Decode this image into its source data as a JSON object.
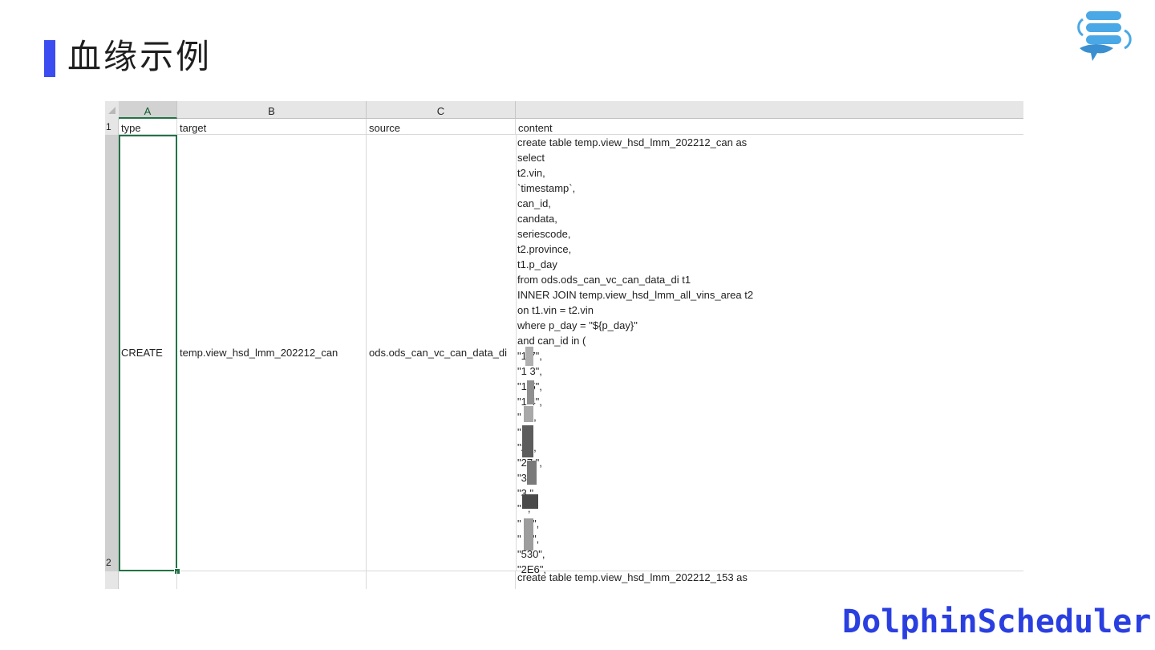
{
  "slide": {
    "title": "血缘示例",
    "brand": "DolphinScheduler",
    "colors": {
      "accent": "#3b4cf0",
      "brand": "#2a3fe0",
      "selection": "#217346"
    }
  },
  "logo_icon": "dolphin-database-sync-icon",
  "spreadsheet": {
    "columns": [
      "A",
      "B",
      "C"
    ],
    "row_numbers": [
      "1",
      "2"
    ],
    "header_row": [
      "type",
      "target",
      "source",
      "content"
    ],
    "row2": {
      "type": "CREATE",
      "target": "temp.view_hsd_lmm_202212_can",
      "source": "ods.ods_can_vc_can_data_di"
    },
    "content_lines": [
      "create table temp.view_hsd_lmm_202212_can as",
      "select",
      "t2.vin,",
      "`timestamp`,",
      "can_id,",
      "candata,",
      "seriescode,",
      "t2.province,",
      "t1.p_day",
      "from ods.ods_can_vc_can_data_di t1",
      "INNER JOIN temp.view_hsd_lmm_all_vins_area t2",
      "on t1.vin = t2.vin",
      "where p_day = \"${p_day}\"",
      "and can_id in (",
      "\"1  7\",",
      "\"1  3\",",
      "\"1  5\",",
      "\"1  4\",",
      "\"   0\",",
      "\"    \",",
      "\"2   \",",
      "\"27  \",",
      "\"3   \",",
      "\"3   \",",
      "\"    \",",
      "\"  5 \",",
      "\"  6 \",",
      "\"530\",",
      "\"2E6\","
    ],
    "row3_content": "create table temp.view_hsd_lmm_202212_153 as"
  }
}
